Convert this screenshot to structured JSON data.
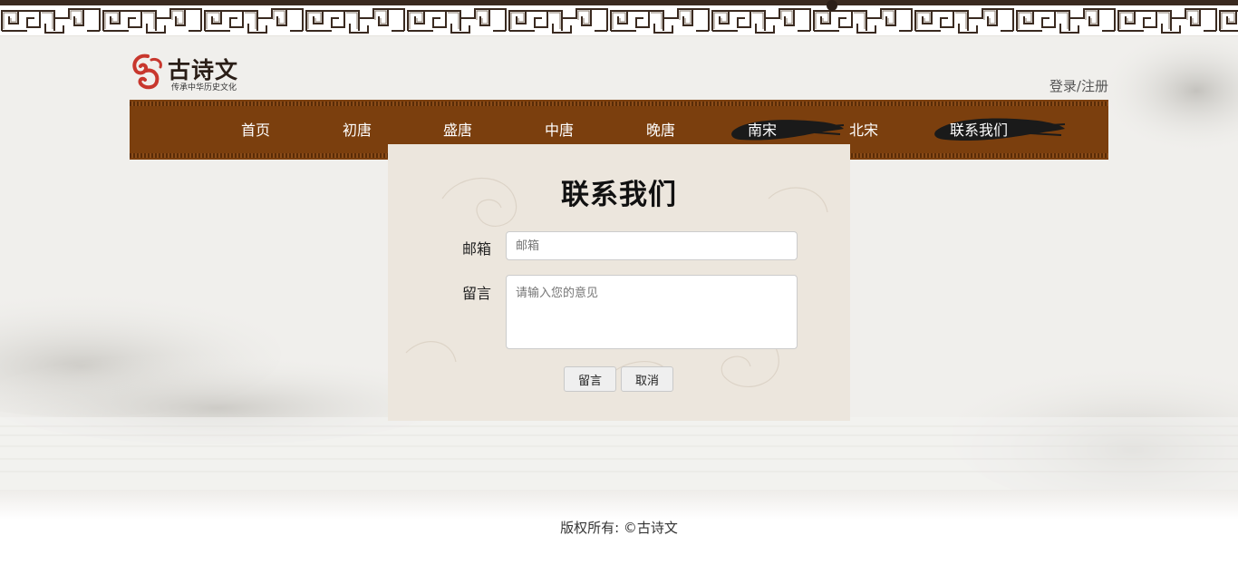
{
  "header": {
    "logo_title": "古诗文",
    "logo_subtitle": "传承中华历史文化",
    "login_label": "登录",
    "separator": "/",
    "register_label": "注册"
  },
  "nav": {
    "items": [
      {
        "label": "首页"
      },
      {
        "label": "初唐"
      },
      {
        "label": "盛唐"
      },
      {
        "label": "中唐"
      },
      {
        "label": "晚唐"
      },
      {
        "label": "南宋"
      },
      {
        "label": "北宋"
      },
      {
        "label": "联系我们"
      }
    ],
    "active": "联系我们",
    "brush_highlighted": [
      "南宋",
      "联系我们"
    ]
  },
  "contact": {
    "title": "联系我们",
    "email_label": "邮箱",
    "email_placeholder": "邮箱",
    "email_value": "",
    "message_label": "留言",
    "message_placeholder": "请输入您的意见",
    "message_value": "",
    "submit_label": "留言",
    "cancel_label": "取消"
  },
  "footer": {
    "copyright": "版权所有: ©古诗文"
  },
  "colors": {
    "nav_bg": "#7b3f0e",
    "page_bg": "#f0efec",
    "logo_red": "#c8372d",
    "brush": "#1a1a1a"
  }
}
